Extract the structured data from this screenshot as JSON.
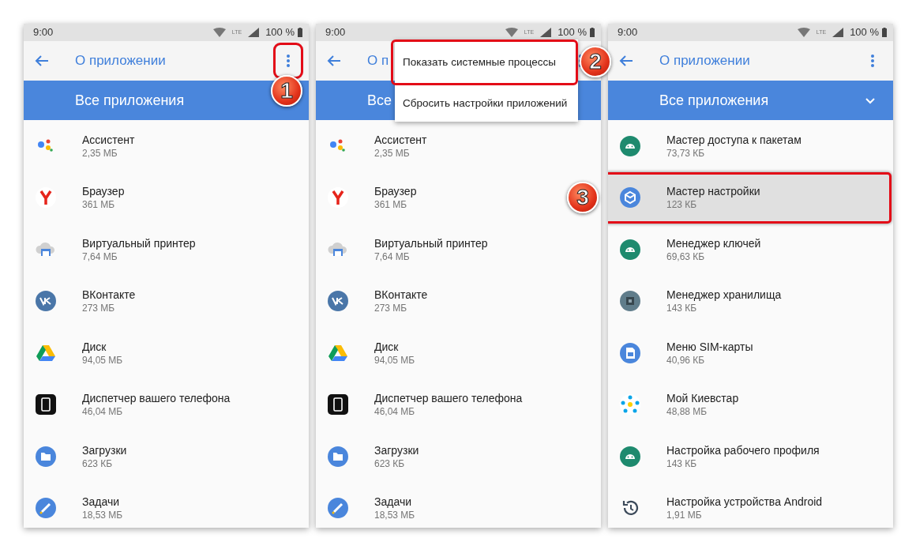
{
  "panels": [
    {
      "status": {
        "time": "9:00",
        "network": "LTE",
        "battery": "100 %"
      },
      "toolbar": {
        "title": "О приложении",
        "menu_highlighted": true
      },
      "filter": {
        "label": "Все приложения",
        "chevron": false
      },
      "apps": [
        {
          "name": "Ассистент",
          "size": "2,35 МБ",
          "kind": "assistant",
          "highlighted": false
        },
        {
          "name": "Браузер",
          "size": "361 МБ",
          "kind": "browser",
          "highlighted": false
        },
        {
          "name": "Виртуальный принтер",
          "size": "7,64 МБ",
          "kind": "printer",
          "highlighted": false
        },
        {
          "name": "ВКонтакте",
          "size": "273 МБ",
          "kind": "vk",
          "highlighted": false
        },
        {
          "name": "Диск",
          "size": "94,05 МБ",
          "kind": "drive",
          "highlighted": false
        },
        {
          "name": "Диспетчер вашего телефона",
          "size": "46,04 МБ",
          "kind": "phone",
          "highlighted": false
        },
        {
          "name": "Загрузки",
          "size": "623 КБ",
          "kind": "downloads",
          "highlighted": false
        },
        {
          "name": "Задачи",
          "size": "18,53 МБ",
          "kind": "tasks",
          "highlighted": false
        }
      ],
      "callout": "1"
    },
    {
      "status": {
        "time": "9:00",
        "network": "LTE",
        "battery": "100 %"
      },
      "toolbar": {
        "title": "О п",
        "menu_highlighted": false
      },
      "filter": {
        "label": "Все",
        "chevron": false
      },
      "menu": [
        {
          "label": "Показать системные процессы",
          "highlighted": true
        },
        {
          "label": "Сбросить настройки приложений",
          "highlighted": false
        }
      ],
      "apps": [
        {
          "name": "Ассистент",
          "size": "2,35 МБ",
          "kind": "assistant",
          "highlighted": false
        },
        {
          "name": "Браузер",
          "size": "361 МБ",
          "kind": "browser",
          "highlighted": false
        },
        {
          "name": "Виртуальный принтер",
          "size": "7,64 МБ",
          "kind": "printer",
          "highlighted": false
        },
        {
          "name": "ВКонтакте",
          "size": "273 МБ",
          "kind": "vk",
          "highlighted": false
        },
        {
          "name": "Диск",
          "size": "94,05 МБ",
          "kind": "drive",
          "highlighted": false
        },
        {
          "name": "Диспетчер вашего телефона",
          "size": "46,04 МБ",
          "kind": "phone",
          "highlighted": false
        },
        {
          "name": "Загрузки",
          "size": "623 КБ",
          "kind": "downloads",
          "highlighted": false
        },
        {
          "name": "Задачи",
          "size": "18,53 МБ",
          "kind": "tasks",
          "highlighted": false
        }
      ],
      "callout": "2"
    },
    {
      "status": {
        "time": "9:00",
        "network": "LTE",
        "battery": "100 %"
      },
      "toolbar": {
        "title": "О приложении",
        "menu_highlighted": false
      },
      "filter": {
        "label": "Все приложения",
        "chevron": true
      },
      "apps": [
        {
          "name": "Мастер доступа к пакетам",
          "size": "73,73 КБ",
          "kind": "android",
          "highlighted": false
        },
        {
          "name": "Мастер настройки",
          "size": "123 КБ",
          "kind": "setup",
          "highlighted": true
        },
        {
          "name": "Менеджер ключей",
          "size": "69,63 КБ",
          "kind": "android",
          "highlighted": false
        },
        {
          "name": "Менеджер хранилища",
          "size": "143 КБ",
          "kind": "storage",
          "highlighted": false
        },
        {
          "name": "Меню SIM-карты",
          "size": "40,96 КБ",
          "kind": "sim",
          "highlighted": false
        },
        {
          "name": "Мой Киевстар",
          "size": "48,88 МБ",
          "kind": "kyivstar",
          "highlighted": false
        },
        {
          "name": "Настройка рабочего профиля",
          "size": "143 КБ",
          "kind": "android",
          "highlighted": false
        },
        {
          "name": "Настройка устройства Android",
          "size": "1,91 МБ",
          "kind": "restore",
          "highlighted": false
        }
      ],
      "callout": "3"
    }
  ]
}
